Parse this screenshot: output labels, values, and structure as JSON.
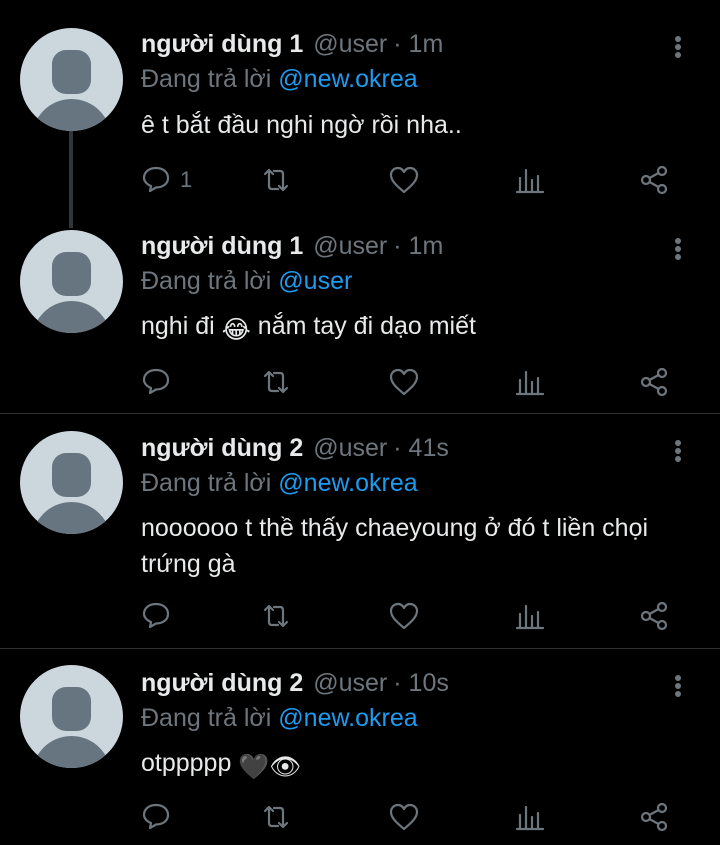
{
  "tweets": [
    {
      "name": "người dùng 1",
      "handle": "@user",
      "time": "· 1m",
      "reply_prefix": "Đang trả lời",
      "reply_to": "@new.okrea",
      "text": "ê t bắt đầu nghi ngờ rồi nha..",
      "reply_count": "1"
    },
    {
      "name": "người dùng 1",
      "handle": "@user",
      "time": "· 1m",
      "reply_prefix": "Đang trả lời",
      "reply_to": "@user",
      "text_before": "nghi đi",
      "emoji": "😂",
      "text_after": "nắm tay đi dạo miết"
    },
    {
      "name": "người dùng 2",
      "handle": "@user",
      "time": "· 41s",
      "reply_prefix": "Đang trả lời",
      "reply_to": "@new.okrea",
      "text": "noooooo t thề thấy chaeyoung ở đó t liền chọi trứng gà"
    },
    {
      "name": "người dùng 2",
      "handle": "@user",
      "time": "· 10s",
      "reply_prefix": "Đang trả lời",
      "reply_to": "@new.okrea",
      "text": "otppppp",
      "emoji": "🖤👁"
    }
  ],
  "icons": {
    "reply": "comment-icon",
    "retweet": "retweet-icon",
    "like": "heart-icon",
    "views": "analytics-icon",
    "share": "share-icon",
    "more": "more-vertical-icon"
  },
  "colors": {
    "background": "#000000",
    "text": "#e7e9ea",
    "muted": "#6e767d",
    "link": "#1d9bf0",
    "avatar_bg": "#ccd6dd",
    "avatar_fg": "#66757f"
  }
}
